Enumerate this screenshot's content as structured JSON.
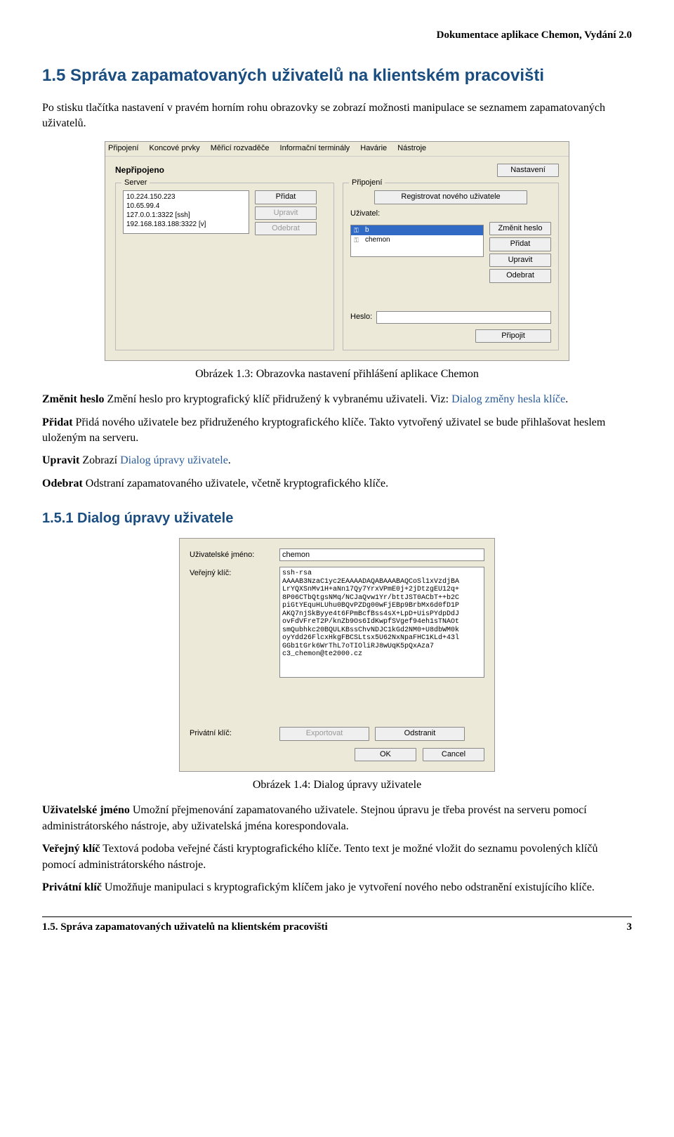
{
  "doc_header": "Dokumentace aplikace Chemon, Vydání 2.0",
  "section1": {
    "num": "1.5",
    "title": "Správa zapamatovaných uživatelů na klientském pracovišti",
    "intro": "Po stisku tlačítka nastavení v pravém horním rohu obrazovky se zobrazí možnosti manipulace se seznamem zapamatovaných uživatelů."
  },
  "shot1": {
    "menu": {
      "m1": "Připojení",
      "m2": "Koncové prvky",
      "m3": "Měřicí rozvaděče",
      "m4": "Informační terminály",
      "m5": "Havárie",
      "m6": "Nástroje"
    },
    "status": "Nepřipojeno",
    "btn_settings": "Nastavení",
    "server_legend": "Server",
    "server_list": {
      "l1": "10.224.150.223",
      "l2": "10.65.99.4",
      "l3": "127.0.0.1:3322 [ssh]",
      "l4": "192.168.183.188:3322 [v]"
    },
    "btn_add": "Přidat",
    "btn_edit": "Upravit",
    "btn_remove": "Odebrat",
    "prip_legend": "Připojení",
    "btn_register": "Registrovat nového uživatele",
    "lbl_user": "Uživatel:",
    "users": {
      "u1": "b",
      "u2": "chemon"
    },
    "btn_chpass": "Změnit heslo",
    "btn_add2": "Přidat",
    "btn_edit2": "Upravit",
    "btn_remove2": "Odebrat",
    "lbl_pass": "Heslo:",
    "btn_connect": "Připojit"
  },
  "caption1": "Obrázek 1.3: Obrazovka nastavení přihlášení aplikace Chemon",
  "defs1": {
    "d1_term": "Změnit heslo",
    "d1_body_a": "Změní heslo pro kryptografický klíč přidružený k vybranému uživateli. Viz: ",
    "d1_link": "Dialog změny hesla klíče",
    "d1_body_b": ".",
    "d2_term": "Přidat",
    "d2_body": "Přidá nového uživatele bez přidruženého kryptografického klíče. Takto vytvořený uživatel se bude přihlašovat heslem uloženým na serveru.",
    "d3_term": "Upravit",
    "d3_body_a": "Zobrazí ",
    "d3_link": "Dialog úpravy uživatele",
    "d3_body_b": ".",
    "d4_term": "Odebrat",
    "d4_body": "Odstraní zapamatovaného uživatele, včetně kryptografického klíče."
  },
  "section2": {
    "num": "1.5.1",
    "title": "Dialog úpravy uživatele"
  },
  "shot2": {
    "lbl_username": "Uživatelské jméno:",
    "val_username": "chemon",
    "lbl_pubkey": "Veřejný klíč:",
    "val_pubkey": "ssh-rsa\nAAAAB3NzaC1yc2EAAAADAQABAAABAQCoSl1xVzdjBA\nLrYQXSnMv1H+aNn17Qy7YrxVPmE0j+2jDtzgEU12q+\n8P06CTbQtgsNMq/NCJaQvw1Yr/bttJST0ACbT++b2C\npiGtYEquHLUhu0BQvPZDg00wFjEBp9BrbMx6d0fD1P\nAKQ7njSkByye4t6FPmBcfBss4sX+LpD+UisPYdpDdJ\novFdVFreT2P/knZb9Os6IdKwpfSVgef94eh1sTNAOt\nsmQubhkc20BQULKBssChvNDJC1kGd2NM0+U8dbWM0k\noyYdd26FlcxHkgFBCSLtsx5U62NxNpaFHC1KLd+43l\nGGb1tGrk6WrThL7oTIOliRJ8wUqK5pQxAza7\nc3_chemon@te2000.cz",
    "lbl_privkey": "Privátní klíč:",
    "btn_export": "Exportovat",
    "btn_delete": "Odstranit",
    "btn_ok": "OK",
    "btn_cancel": "Cancel"
  },
  "caption2": "Obrázek 1.4: Dialog úpravy uživatele",
  "defs2": {
    "d1_term": "Uživatelské jméno",
    "d1_body": "Umožní přejmenování zapamatovaného uživatele. Stejnou úpravu je třeba provést na serveru pomocí administrátorského nástroje, aby uživatelská jména korespondovala.",
    "d2_term": "Veřejný klíč",
    "d2_body": "Textová podoba veřejné části kryptografického klíče. Tento text je možné vložit do seznamu povolených klíčů pomocí administrátorského nástroje.",
    "d3_term": "Privátní klíč",
    "d3_body": "Umožňuje manipulaci s kryptografickým klíčem jako je vytvoření nového nebo odstranění existujícího klíče."
  },
  "footer": {
    "left": "1.5. Správa zapamatovaných uživatelů na klientském pracovišti",
    "right": "3"
  }
}
